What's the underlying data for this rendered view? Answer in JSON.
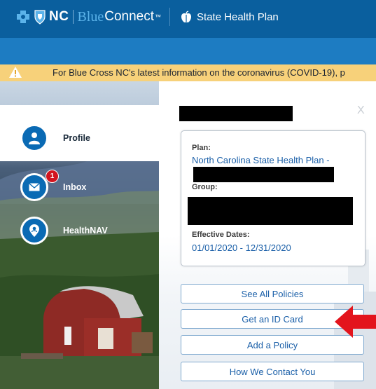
{
  "header": {
    "brand_nc": "NC",
    "brand_blue": "Blue",
    "brand_connect": "Connect",
    "brand_tm": "™",
    "plan_name": "State Health Plan"
  },
  "alert": {
    "icon": "warning-icon",
    "text": "For Blue Cross NC's latest information on the coronavirus (COVID-19), p"
  },
  "nav": {
    "items": [
      {
        "label": "Profile",
        "icon": "person-icon"
      },
      {
        "label": "Inbox",
        "icon": "envelope-icon",
        "badge": "1"
      },
      {
        "label": "HealthNAV",
        "icon": "location-pin-icon"
      }
    ]
  },
  "panel": {
    "close": "X",
    "plan_label": "Plan:",
    "plan_value": "North Carolina State Health Plan -",
    "group_label": "Group:",
    "effective_label": "Effective Dates:",
    "effective_value": "01/01/2020 - 12/31/2020",
    "buttons": [
      "See All Policies",
      "Get an ID Card",
      "Add a Policy",
      "How We Contact You"
    ]
  },
  "colors": {
    "header": "#0a5f9e",
    "subnav": "#1d7cc2",
    "alert": "#f7d17a",
    "accent_text": "#1a5fa8",
    "badge": "#d2141f",
    "arrow": "#e3141c"
  }
}
